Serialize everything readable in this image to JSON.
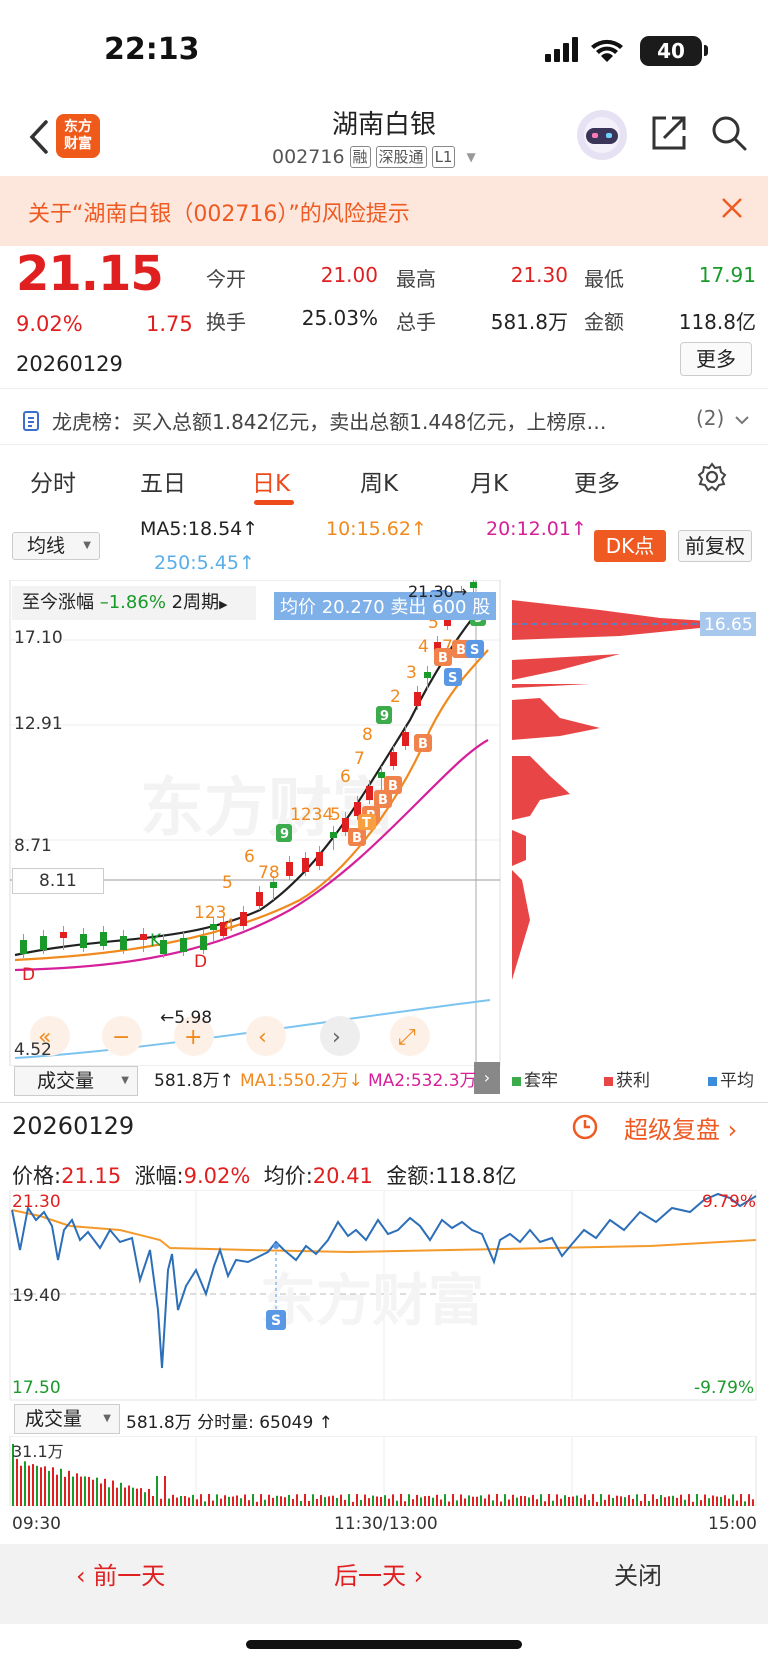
{
  "status": {
    "time": "22:13",
    "battery": "40"
  },
  "header": {
    "logo": [
      "东方",
      "财富"
    ],
    "title": "湖南白银",
    "code": "002716",
    "tags": [
      "融",
      "深股通",
      "L1"
    ]
  },
  "risk_banner": {
    "text": "关于“湖南白银（002716）”的风险提示"
  },
  "quote": {
    "price": "21.15",
    "change_pct": "9.02%",
    "change": "1.75",
    "date": "20260129",
    "fields": [
      {
        "label": "今开",
        "value": "21.00",
        "color": "#e02020"
      },
      {
        "label": "最高",
        "value": "21.30",
        "color": "#e02020"
      },
      {
        "label": "最低",
        "value": "17.91",
        "color": "#1a9a2a"
      },
      {
        "label": "换手",
        "value": "25.03%",
        "color": "#222"
      },
      {
        "label": "总手",
        "value": "581.8万",
        "color": "#222"
      },
      {
        "label": "金额",
        "value": "118.8亿",
        "color": "#222"
      }
    ],
    "more": "更多"
  },
  "longhubang": {
    "text": "龙虎榜：买入总额1.842亿元，卖出总额1.448亿元，上榜原…",
    "count": "(2)"
  },
  "tabs": [
    "分时",
    "五日",
    "日K",
    "周K",
    "月K",
    "更多"
  ],
  "ma": {
    "selector": "均线",
    "ma5": "MA5:18.54↑",
    "ma10": "10:15.62↑",
    "ma20": "20:12.01↑",
    "ma250": "250:5.45↑",
    "dk_button": "DK点",
    "adjust_button": "前复权"
  },
  "kchart": {
    "gain_label": "至今涨幅",
    "gain_value": "–1.86%",
    "period": "2周期",
    "avg_tooltip": "均价 20.270  卖出 600 股",
    "high_marker": "21.30→",
    "low_marker": "←5.98",
    "y_labels": [
      "17.10",
      "12.91",
      "8.71",
      "8.11",
      "4.52"
    ],
    "right_price": "16.65",
    "legend": [
      "套牢",
      "获利",
      "平均"
    ]
  },
  "volume": {
    "selector": "成交量",
    "value": "581.8万↑",
    "ma1": "MA1:550.2万↓",
    "ma2": "MA2:532.3万"
  },
  "intraday": {
    "date": "20260129",
    "super_replay": "超级复盘",
    "price_label": "价格:",
    "price": "21.15",
    "pct_label": "涨幅:",
    "pct": "9.02%",
    "avg_label": "均价:",
    "avg": "20.41",
    "amount_label": "金额:",
    "amount": "118.8亿",
    "y_top": "21.30",
    "y_mid": "19.40",
    "y_bot": "17.50",
    "pct_top": "9.79%",
    "pct_bot": "-9.79%",
    "vol_selector": "成交量",
    "vol_value": "581.8万  分时量: 65049 ↑",
    "vol_max": "31.1万",
    "times": [
      "09:30",
      "11:30/13:00",
      "15:00"
    ]
  },
  "bottom_nav": {
    "prev": "前一天",
    "next": "后一天",
    "close": "关闭"
  }
}
